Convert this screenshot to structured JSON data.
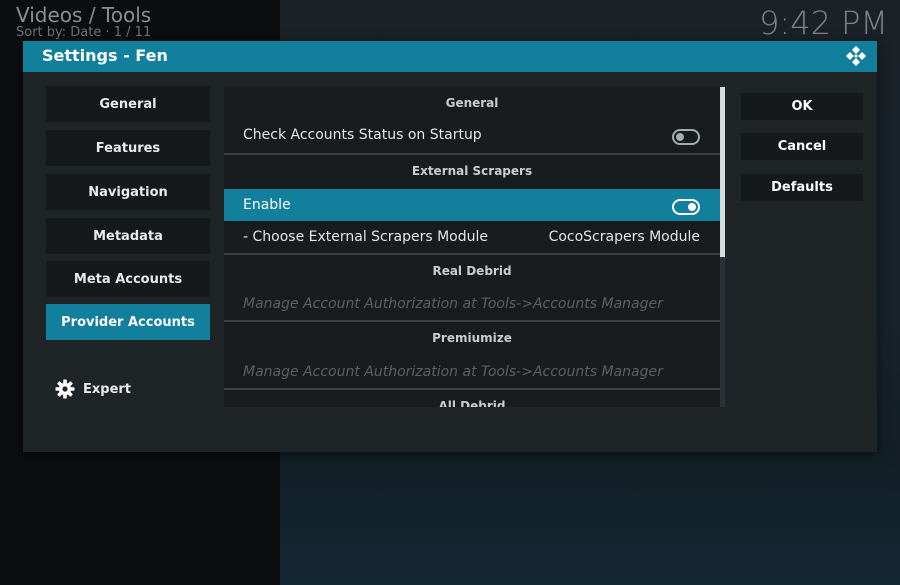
{
  "background": {
    "breadcrumb": "Videos / Tools",
    "sort_info": "Sort by: Date  ·  1 / 11",
    "clock": "9:42 PM"
  },
  "dialog": {
    "title": "Settings - Fen",
    "accent_color": "#127f9c",
    "categories": [
      {
        "label": "General"
      },
      {
        "label": "Features"
      },
      {
        "label": "Navigation"
      },
      {
        "label": "Metadata"
      },
      {
        "label": "Meta Accounts"
      },
      {
        "label": "Provider Accounts"
      }
    ],
    "active_category": "Provider Accounts",
    "settings_level": "Expert",
    "settings": {
      "group_general": "General",
      "check_accounts": {
        "label": "Check Accounts Status on Startup",
        "enabled": false
      },
      "group_external": "External Scrapers",
      "enable": {
        "label": "Enable",
        "enabled": true
      },
      "choose_module": {
        "label": "- Choose External Scrapers Module",
        "value": "CocoScrapers Module"
      },
      "group_real_debrid": "Real Debrid",
      "rd_info": "Manage Account Authorization at Tools->Accounts Manager",
      "group_premiumize": "Premiumize",
      "pm_info": "Manage Account Authorization at Tools->Accounts Manager",
      "group_all_debrid": "All Debrid"
    },
    "buttons": {
      "ok": "OK",
      "cancel": "Cancel",
      "defaults": "Defaults"
    }
  }
}
